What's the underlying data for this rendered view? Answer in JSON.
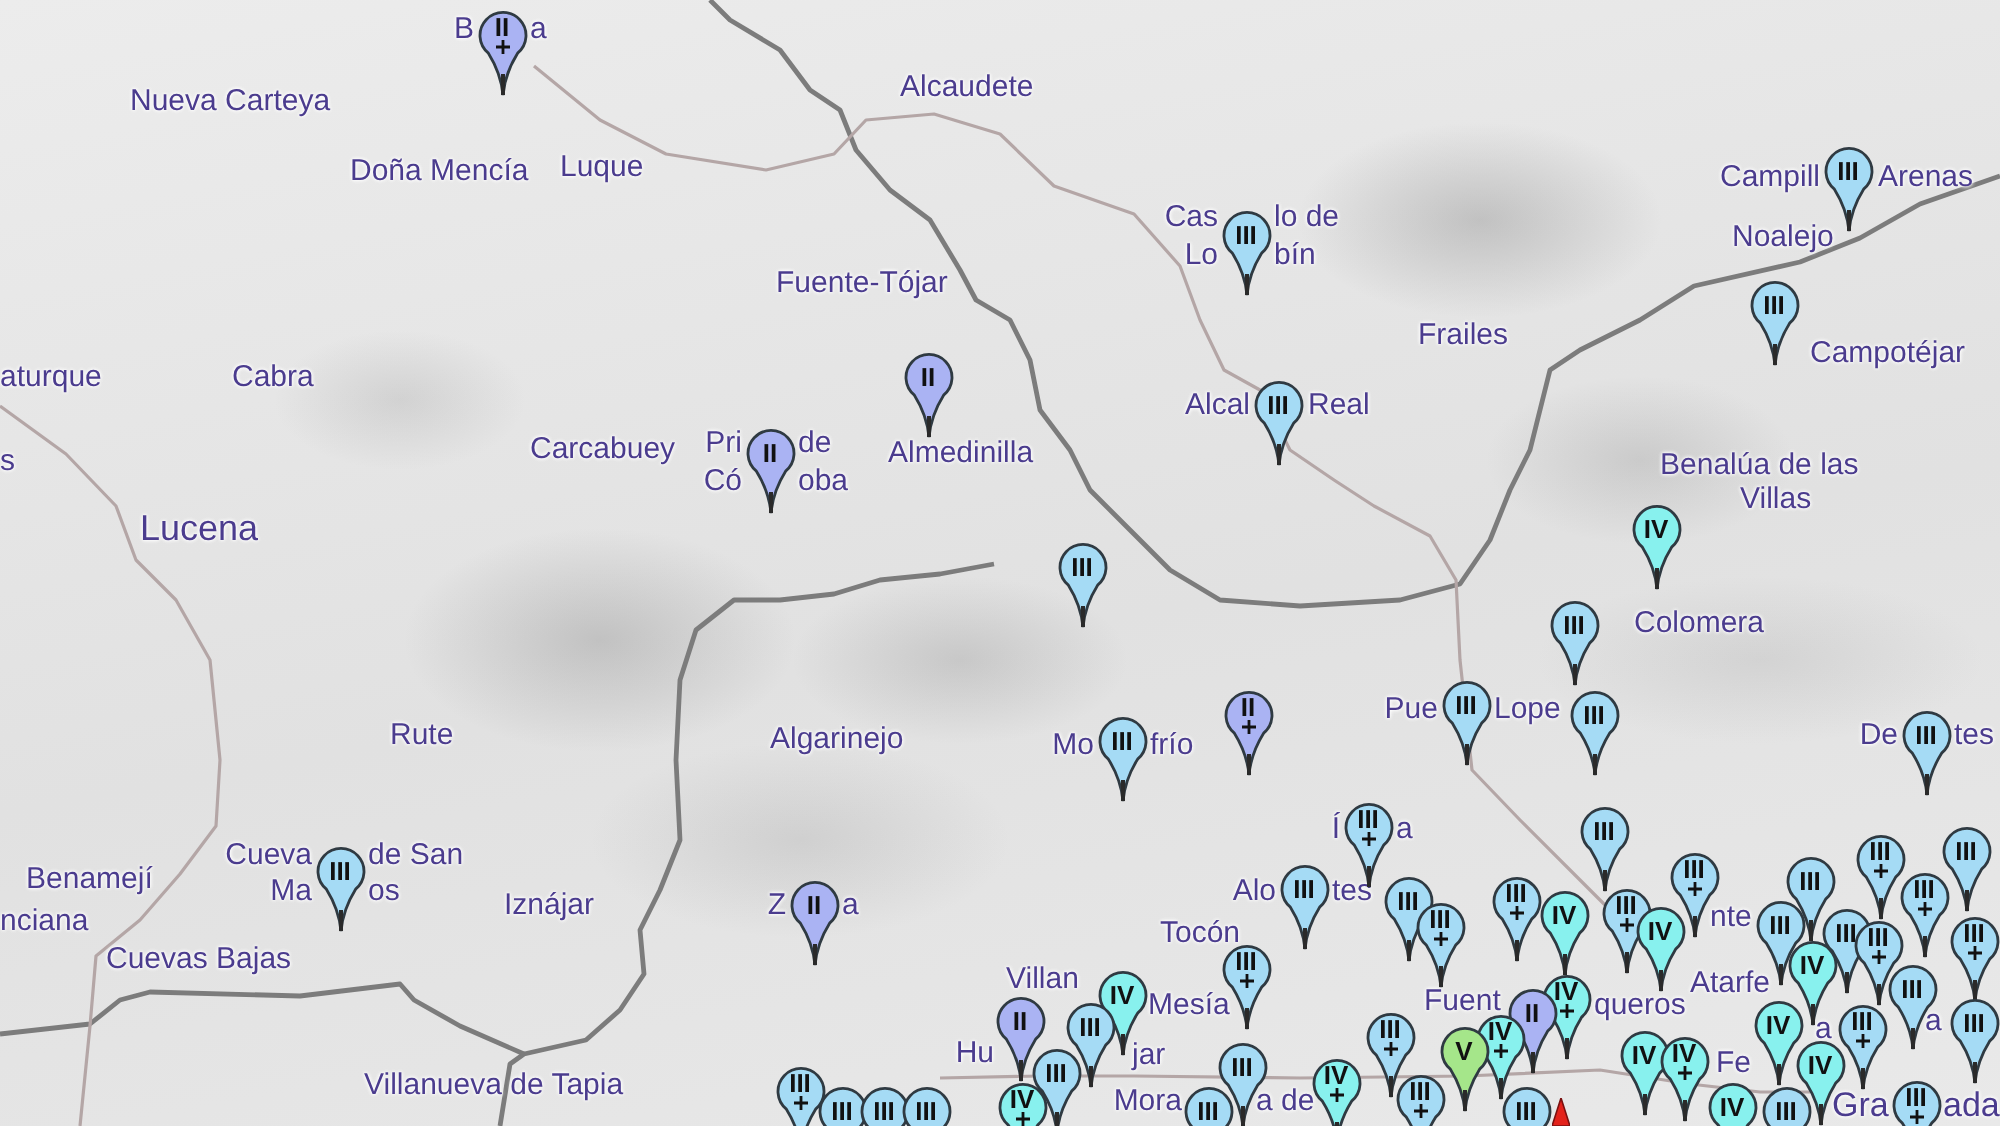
{
  "map": {
    "place_labels": [
      {
        "text": "B",
        "kind": "town"
      },
      {
        "text": "a",
        "kind": "town"
      },
      {
        "text": "Nueva Carteya",
        "kind": "town"
      },
      {
        "text": "Alcaudete",
        "kind": "town"
      },
      {
        "text": "Doña Mencía",
        "kind": "town"
      },
      {
        "text": "Luque",
        "kind": "town"
      },
      {
        "text": "Campill",
        "kind": "town"
      },
      {
        "text": "Arenas",
        "kind": "town"
      },
      {
        "text": "Cas",
        "kind": "town"
      },
      {
        "text": "lo de",
        "kind": "town"
      },
      {
        "text": "Lo",
        "kind": "town"
      },
      {
        "text": "bín",
        "kind": "town"
      },
      {
        "text": "Noalejo",
        "kind": "town"
      },
      {
        "text": "Fuente-Tójar",
        "kind": "town"
      },
      {
        "text": "Frailes",
        "kind": "town"
      },
      {
        "text": "Campotéjar",
        "kind": "town"
      },
      {
        "text": "aturque",
        "kind": "town"
      },
      {
        "text": "Cabra",
        "kind": "town"
      },
      {
        "text": "Alcal",
        "kind": "town"
      },
      {
        "text": "Real",
        "kind": "town"
      },
      {
        "text": "s",
        "kind": "town"
      },
      {
        "text": "Carcabuey",
        "kind": "town"
      },
      {
        "text": "Pri",
        "kind": "town"
      },
      {
        "text": "de",
        "kind": "town"
      },
      {
        "text": "Almedinilla",
        "kind": "town"
      },
      {
        "text": "Có",
        "kind": "town"
      },
      {
        "text": "oba",
        "kind": "town"
      },
      {
        "text": "Benalúa de las",
        "kind": "town"
      },
      {
        "text": "Villas",
        "kind": "town"
      },
      {
        "text": "Lucena",
        "kind": "city"
      },
      {
        "text": "Colomera",
        "kind": "town"
      },
      {
        "text": "Pue",
        "kind": "town"
      },
      {
        "text": "Lope",
        "kind": "town"
      },
      {
        "text": "Rute",
        "kind": "town"
      },
      {
        "text": "Algarinejo",
        "kind": "town"
      },
      {
        "text": "Mo",
        "kind": "town"
      },
      {
        "text": "frío",
        "kind": "town"
      },
      {
        "text": "De",
        "kind": "town"
      },
      {
        "text": "tes",
        "kind": "town"
      },
      {
        "text": "Í",
        "kind": "town"
      },
      {
        "text": "a",
        "kind": "town"
      },
      {
        "text": "Cueva",
        "kind": "town"
      },
      {
        "text": "de San",
        "kind": "town"
      },
      {
        "text": "Benamejí",
        "kind": "town"
      },
      {
        "text": "Ma",
        "kind": "town"
      },
      {
        "text": "os",
        "kind": "town"
      },
      {
        "text": "nciana",
        "kind": "town"
      },
      {
        "text": "Iznájar",
        "kind": "town"
      },
      {
        "text": "Z",
        "kind": "town"
      },
      {
        "text": "a",
        "kind": "town"
      },
      {
        "text": "Tocón",
        "kind": "town"
      },
      {
        "text": "Alo",
        "kind": "town"
      },
      {
        "text": "tes",
        "kind": "town"
      },
      {
        "text": "nte",
        "kind": "town"
      },
      {
        "text": "Cuevas Bajas",
        "kind": "town"
      },
      {
        "text": "Villan",
        "kind": "town"
      },
      {
        "text": "Mesía",
        "kind": "town"
      },
      {
        "text": "Fuent",
        "kind": "town"
      },
      {
        "text": "queros",
        "kind": "town"
      },
      {
        "text": "Atarfe",
        "kind": "town"
      },
      {
        "text": "a",
        "kind": "town"
      },
      {
        "text": "a",
        "kind": "town"
      },
      {
        "text": "Hu",
        "kind": "town"
      },
      {
        "text": "jar",
        "kind": "town"
      },
      {
        "text": "Villanueva de Tapia",
        "kind": "town"
      },
      {
        "text": "Fe",
        "kind": "town"
      },
      {
        "text": "Mora",
        "kind": "town"
      },
      {
        "text": "a de",
        "kind": "town"
      },
      {
        "text": "Gra",
        "kind": "capital"
      },
      {
        "text": "ada",
        "kind": "capital"
      }
    ],
    "markers": [
      {
        "numeral": "II",
        "color": "#aab3f3",
        "cross": true
      },
      {
        "numeral": "III",
        "color": "#a5dbf5",
        "cross": false
      },
      {
        "numeral": "III",
        "color": "#a5dbf5",
        "cross": false
      },
      {
        "numeral": "III",
        "color": "#a5dbf5",
        "cross": false
      },
      {
        "numeral": "II",
        "color": "#aab3f3",
        "cross": false
      },
      {
        "numeral": "II",
        "color": "#aab3f3",
        "cross": false
      },
      {
        "numeral": "III",
        "color": "#a5dbf5",
        "cross": false
      },
      {
        "numeral": "III",
        "color": "#a5dbf5",
        "cross": false
      },
      {
        "numeral": "IV",
        "color": "#88f1ee",
        "cross": false
      },
      {
        "numeral": "III",
        "color": "#a5dbf5",
        "cross": false
      },
      {
        "numeral": "III",
        "color": "#a5dbf5",
        "cross": false
      },
      {
        "numeral": "II",
        "color": "#aab3f3",
        "cross": true
      },
      {
        "numeral": "III",
        "color": "#a5dbf5",
        "cross": false
      },
      {
        "numeral": "III",
        "color": "#a5dbf5",
        "cross": false
      },
      {
        "numeral": "III",
        "color": "#a5dbf5",
        "cross": false
      },
      {
        "numeral": "III",
        "color": "#a5dbf5",
        "cross": false
      },
      {
        "numeral": "II",
        "color": "#aab3f3",
        "cross": false
      },
      {
        "numeral": "III",
        "color": "#a5dbf5",
        "cross": false
      },
      {
        "numeral": "III",
        "color": "#a5dbf5",
        "cross": true
      },
      {
        "numeral": "III",
        "color": "#a5dbf5",
        "cross": false
      },
      {
        "numeral": "III",
        "color": "#a5dbf5",
        "cross": true
      },
      {
        "numeral": "III",
        "color": "#a5dbf5",
        "cross": true
      },
      {
        "numeral": "IV",
        "color": "#88f1ee",
        "cross": false
      },
      {
        "numeral": "III",
        "color": "#a5dbf5",
        "cross": false
      },
      {
        "numeral": "III",
        "color": "#a5dbf5",
        "cross": true
      },
      {
        "numeral": "IV",
        "color": "#88f1ee",
        "cross": false
      },
      {
        "numeral": "III",
        "color": "#a5dbf5",
        "cross": true
      },
      {
        "numeral": "III",
        "color": "#a5dbf5",
        "cross": false
      },
      {
        "numeral": "III",
        "color": "#a5dbf5",
        "cross": false
      },
      {
        "numeral": "III",
        "color": "#a5dbf5",
        "cross": false
      },
      {
        "numeral": "III",
        "color": "#a5dbf5",
        "cross": true
      },
      {
        "numeral": "III",
        "color": "#a5dbf5",
        "cross": true
      },
      {
        "numeral": "III",
        "color": "#a5dbf5",
        "cross": false
      },
      {
        "numeral": "III",
        "color": "#a5dbf5",
        "cross": true
      },
      {
        "numeral": "IV",
        "color": "#88f1ee",
        "cross": false
      },
      {
        "numeral": "III",
        "color": "#a5dbf5",
        "cross": true
      },
      {
        "numeral": "III",
        "color": "#a5dbf5",
        "cross": true
      },
      {
        "numeral": "II",
        "color": "#aab3f3",
        "cross": false
      },
      {
        "numeral": "III",
        "color": "#a5dbf5",
        "cross": false
      },
      {
        "numeral": "IV",
        "color": "#88f1ee",
        "cross": false
      },
      {
        "numeral": "III",
        "color": "#a5dbf5",
        "cross": true
      },
      {
        "numeral": "IV",
        "color": "#88f1ee",
        "cross": true
      },
      {
        "numeral": "II",
        "color": "#aab3f3",
        "cross": false
      },
      {
        "numeral": "IV",
        "color": "#88f1ee",
        "cross": true
      },
      {
        "numeral": "IV",
        "color": "#88f1ee",
        "cross": false
      },
      {
        "numeral": "III",
        "color": "#a5dbf5",
        "cross": true
      },
      {
        "numeral": "III",
        "color": "#a5dbf5",
        "cross": false
      },
      {
        "numeral": "III",
        "color": "#a5dbf5",
        "cross": false
      },
      {
        "numeral": "III",
        "color": "#a5dbf5",
        "cross": true
      },
      {
        "numeral": "III",
        "color": "#a5dbf5",
        "cross": false
      },
      {
        "numeral": "III",
        "color": "#a5dbf5",
        "cross": false
      },
      {
        "numeral": "III",
        "color": "#a5dbf5",
        "cross": false
      },
      {
        "numeral": "IV",
        "color": "#88f1ee",
        "cross": true
      },
      {
        "numeral": "III",
        "color": "#a5dbf5",
        "cross": false
      },
      {
        "numeral": "III",
        "color": "#a5dbf5",
        "cross": false
      },
      {
        "numeral": "III",
        "color": "#a5dbf5",
        "cross": false
      },
      {
        "numeral": "IV",
        "color": "#88f1ee",
        "cross": true
      },
      {
        "numeral": "III",
        "color": "#a5dbf5",
        "cross": true
      },
      {
        "numeral": "V",
        "color": "#a5e68a",
        "cross": false
      },
      {
        "numeral": "III",
        "color": "#a5dbf5",
        "cross": false
      },
      {
        "numeral": "IV",
        "color": "#88f1ee",
        "cross": false
      },
      {
        "numeral": "IV",
        "color": "#88f1ee",
        "cross": true
      },
      {
        "numeral": "IV",
        "color": "#88f1ee",
        "cross": false
      },
      {
        "numeral": "III",
        "color": "#a5dbf5",
        "cross": false
      },
      {
        "numeral": "IV",
        "color": "#88f1ee",
        "cross": false
      },
      {
        "numeral": "III",
        "color": "#a5dbf5",
        "cross": true
      }
    ]
  }
}
